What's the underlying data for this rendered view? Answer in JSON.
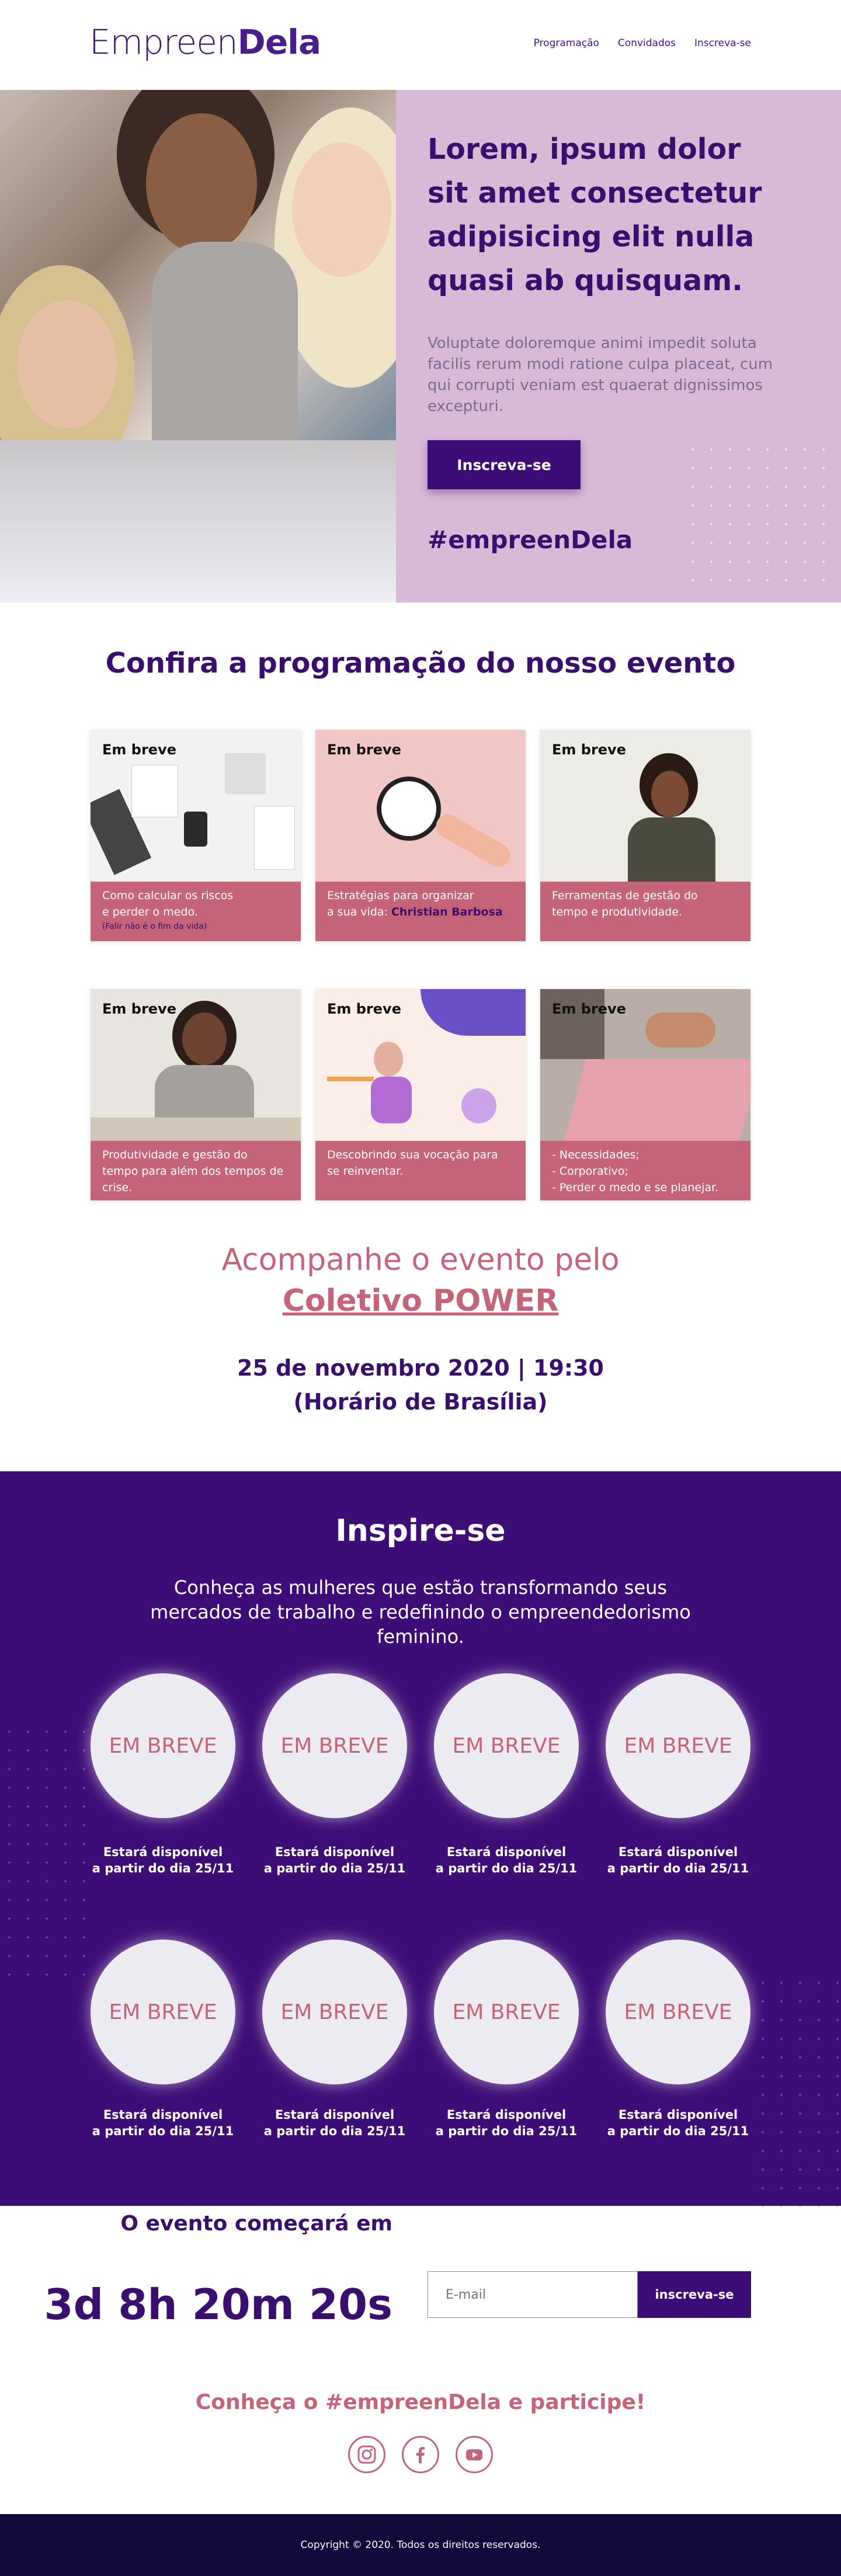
{
  "header": {
    "logo_part1": "Empreen",
    "logo_part2": "Dela",
    "nav": [
      "Programação",
      "Convidados",
      "Inscreva-se"
    ]
  },
  "hero": {
    "title": "Lorem, ipsum dolor sit amet consectetur adipisicing elit nulla quasi ab quisquam.",
    "text": "Voluptate doloremque animi impedit soluta facilis rerum modi ratione culpa placeat, cum qui corrupti veniam est quaerat dignissimos excepturi.",
    "button": "Inscreva-se",
    "hashtag": "#empreenDela"
  },
  "programacao": {
    "title": "Confira a programação do nosso evento",
    "badge": "Em breve",
    "cards": [
      {
        "line1": "Como calcular os riscos",
        "line2": "e perder o medo.",
        "small": "(Falir não é o fim da vida)"
      },
      {
        "line1": "Estratégias para organizar",
        "line2_prefix": "a sua vida: ",
        "highlight": "Christian Barbosa"
      },
      {
        "line1": "Ferramentas de gestão do",
        "line2": "tempo e produtividade."
      },
      {
        "line1": "Produtividade e gestão do",
        "line2": "tempo para além dos tempos de",
        "line3": "crise."
      },
      {
        "line1": "Descobrindo sua vocação para",
        "line2": "se reinventar."
      },
      {
        "line1": "- Necessidades;",
        "line2": "- Corporativo;",
        "line3": "- Perder o medo e se planejar."
      }
    ]
  },
  "acompanhe": {
    "text": "Acompanhe o evento pelo",
    "link": "Coletivo POWER",
    "date_line1": "25 de novembro 2020 | 19:30",
    "date_line2": "(Horário de Brasília)"
  },
  "inspire": {
    "title": "Inspire-se",
    "text": "Conheça as mulheres que estão transformando seus mercados de trabalho e redefinindo o empreendedorismo feminino.",
    "circle_label": "EM BREVE",
    "avail_line1": "Estará disponível",
    "avail_line2": "a partir do dia 25/11"
  },
  "countdown": {
    "label": "O evento começará em",
    "value": "3d 8h 20m 20s",
    "email_placeholder": "E-mail",
    "button": "inscreva-se"
  },
  "social": {
    "title": "Conheça o #empreenDela e participe!",
    "icons": [
      "instagram-icon",
      "facebook-icon",
      "youtube-icon"
    ]
  },
  "footer": {
    "copyright": "Copyright © 2020. Todos os direitos reservados."
  },
  "colors": {
    "primary": "#3d0d77",
    "pink": "#c56478",
    "lilac": "#d8b9d6",
    "footer": "#13093a"
  }
}
